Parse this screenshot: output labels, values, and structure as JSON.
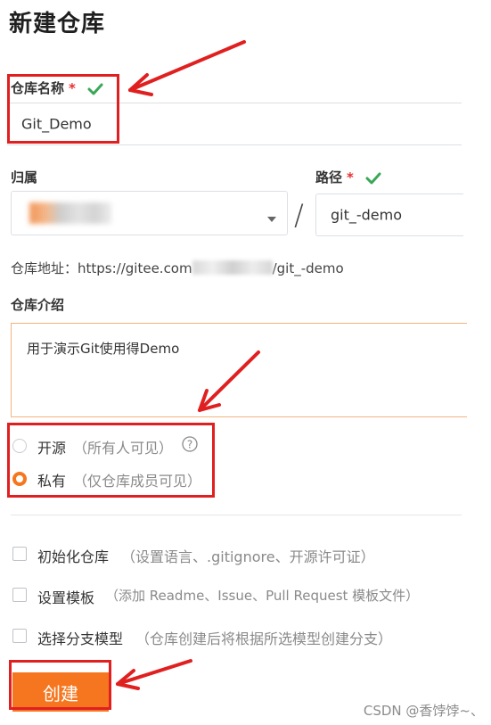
{
  "page": {
    "title": "新建仓库"
  },
  "repo_name": {
    "label": "仓库名称",
    "required_mark": "*",
    "value": "Git_Demo"
  },
  "owner": {
    "label": "归属"
  },
  "path": {
    "label": "路径",
    "required_mark": "*",
    "separator": "/",
    "value": "git_-demo"
  },
  "repo_address": {
    "prefix": "仓库地址：https://gitee.com",
    "suffix": "/git_-demo"
  },
  "description": {
    "label": "仓库介绍",
    "value": "用于演示Git使用得Demo"
  },
  "visibility": {
    "options": [
      {
        "label": "开源",
        "hint": "（所有人可见）",
        "checked": false
      },
      {
        "label": "私有",
        "hint": "（仅仓库成员可见）",
        "checked": true
      }
    ]
  },
  "extras": [
    {
      "label": "初始化仓库",
      "hint": "（设置语言、.gitignore、开源许可证）"
    },
    {
      "label": "设置模板",
      "hint": "（添加 Readme、Issue、Pull Request 模板文件）"
    },
    {
      "label": "选择分支模型",
      "hint": "（仓库创建后将根据所选模型创建分支）"
    }
  ],
  "actions": {
    "create_label": "创建"
  },
  "watermark": "CSDN @香饽饽~、",
  "colors": {
    "accent": "#f5761e",
    "annotation_red": "#e02020",
    "valid_green": "#3aa757"
  }
}
